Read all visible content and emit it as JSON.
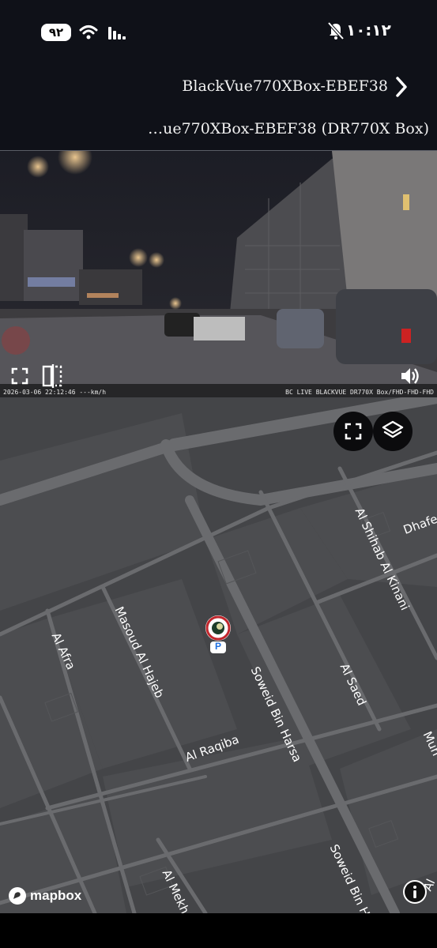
{
  "status_bar": {
    "battery": "٩٢",
    "time": "١٠:١٢"
  },
  "header": {
    "title": "BlackVue770XBox-EBEF38",
    "subtitle": "…ue770XBox-EBEF38 (DR770X Box)"
  },
  "video": {
    "overlay_left": "2026-03-06 22:12:46 ---km/h",
    "overlay_right": "BC LIVE BLACKVUE DR770X Box/FHD-FHD-FHD"
  },
  "map": {
    "roads": {
      "al_afra": "Al Afra",
      "masoud": "Masoud Al Hajeb",
      "al_raqiba": "Al Raqiba",
      "soweid_1": "Soweid Bin Harsa",
      "soweid_2": "Soweid Bin H",
      "al_saed": "Al Saed",
      "al_shihab": "Al Shihab Al Kinani",
      "dhafer": "Dhafer",
      "al_mekhe": "Al Mekhe",
      "mun": "Mun",
      "al_right": "Al"
    },
    "parking_label": "P",
    "attribution": "mapbox"
  },
  "icons": [
    "wifi-icon",
    "signal-icon",
    "mute-bell-icon",
    "chevron-right-icon",
    "fullscreen-icon",
    "split-view-icon",
    "volume-icon",
    "layers-icon",
    "info-icon",
    "mapbox-logo-icon",
    "vehicle-marker-icon"
  ]
}
